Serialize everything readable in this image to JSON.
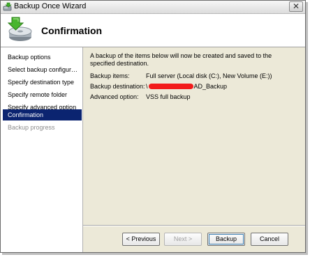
{
  "window": {
    "title": "Backup Once Wizard",
    "close_symbol": "✕",
    "icons": {
      "title": "backup-wizard-icon",
      "header": "backup-disk-icon",
      "close": "close-icon"
    }
  },
  "header": {
    "title": "Confirmation"
  },
  "nav": {
    "items": [
      {
        "label": "Backup options",
        "state": "normal"
      },
      {
        "label": "Select backup configur…",
        "state": "normal"
      },
      {
        "label": "Specify destination type",
        "state": "normal"
      },
      {
        "label": "Specify remote folder",
        "state": "normal"
      },
      {
        "label": "Specify advanced option",
        "state": "normal"
      },
      {
        "label": "Confirmation",
        "state": "selected"
      },
      {
        "label": "Backup progress",
        "state": "disabled"
      }
    ]
  },
  "content": {
    "intro": "A backup of the items below will now be created and saved to the specified destination.",
    "rows": [
      {
        "label": "Backup items:",
        "value": "Full server (Local disk (C:), New Volume (E:))"
      },
      {
        "label": "Backup destination:",
        "value_prefix": "\\",
        "value_suffix": "AD_Backup"
      },
      {
        "label": "Advanced option:",
        "value": "VSS full backup"
      }
    ]
  },
  "buttons": {
    "previous": "< Previous",
    "next": "Next >",
    "backup": "Backup",
    "cancel": "Cancel"
  },
  "colors": {
    "nav_selected": "#0b2470",
    "redaction": "#f21b1b",
    "dialog_background": "#ece9d8"
  }
}
